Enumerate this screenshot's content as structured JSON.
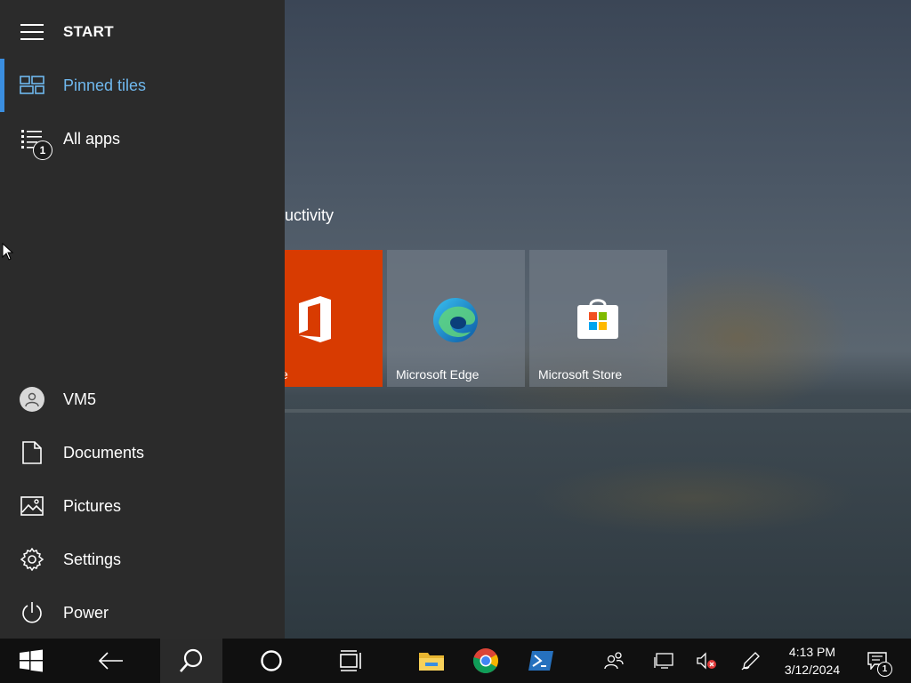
{
  "start_menu": {
    "header_label": "START",
    "nav": {
      "pinned_tiles_label": "Pinned tiles",
      "all_apps_label": "All apps",
      "all_apps_badge": "1"
    },
    "bottom": {
      "user_label": "VM5",
      "documents_label": "Documents",
      "pictures_label": "Pictures",
      "settings_label": "Settings",
      "power_label": "Power"
    },
    "accent_color": "#3a8ee0"
  },
  "tiles": {
    "group_title": "uctivity",
    "office": {
      "label": "e",
      "color": "#d83b01"
    },
    "edge": {
      "label": "Microsoft Edge"
    },
    "store": {
      "label": "Microsoft Store"
    }
  },
  "taskbar": {
    "time": "4:13 PM",
    "date": "3/12/2024",
    "notification_count": "1",
    "icons": [
      "windows-start-icon",
      "back-arrow-icon",
      "search-icon",
      "cortana-icon",
      "task-view-icon",
      "file-explorer-icon",
      "chrome-icon",
      "powershell-icon",
      "people-icon",
      "network-icon",
      "volume-muted-icon",
      "pen-icon",
      "action-center-icon"
    ]
  }
}
